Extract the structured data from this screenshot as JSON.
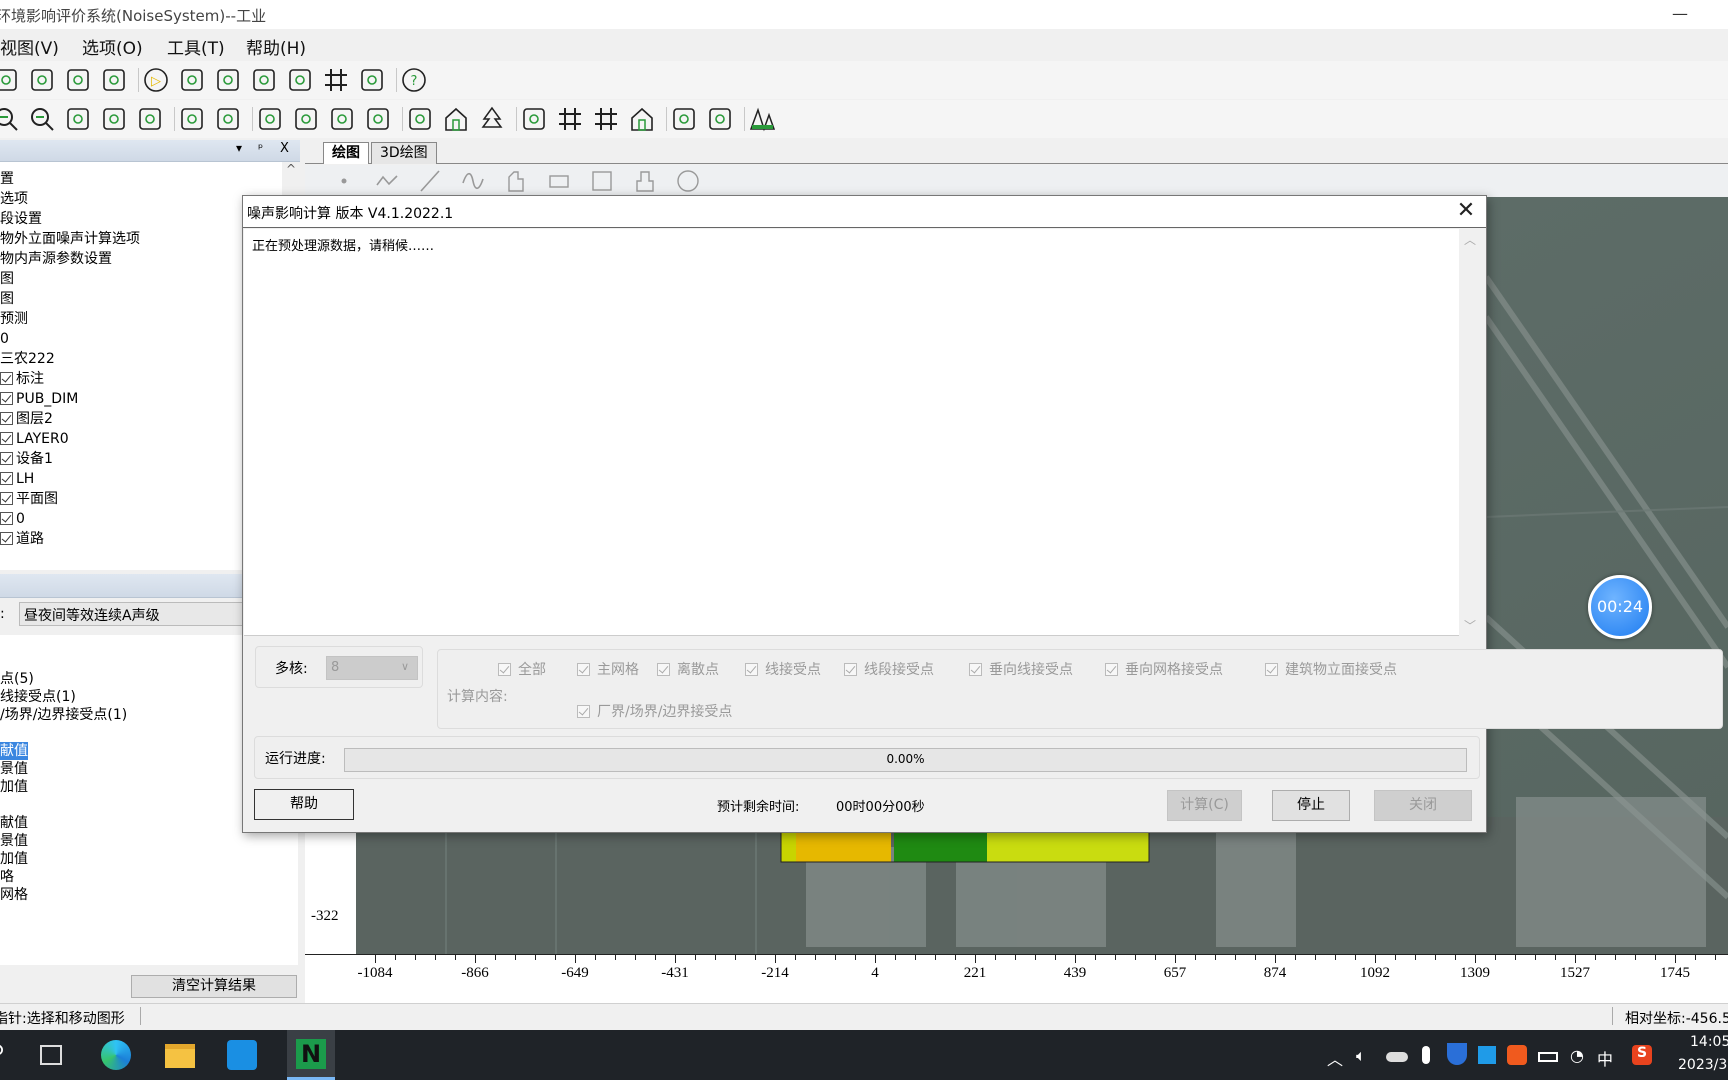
{
  "window": {
    "title": "环境影响评价系统(NoiseSystem)--工业",
    "minimize": "—"
  },
  "menu": [
    "视图(V)",
    "选项(O)",
    "工具(T)",
    "帮助(H)"
  ],
  "toolbar1": [
    "save-icon",
    "view-2d-icon",
    "view-ring-icon",
    "view-3d-icon",
    "|",
    "play-icon",
    "run-hex-icon",
    "image-export-icon",
    "image-print-icon",
    "file-settings-icon",
    "grid-settings-icon",
    "monitor-settings-icon",
    "|",
    "help-icon"
  ],
  "toolbar2": [
    "zoom-in-icon",
    "zoom-out-icon",
    "select-box-icon",
    "select-node-icon",
    "select-polygon-icon",
    "|",
    "ruler-icon",
    "map-refresh-icon",
    "|",
    "factory-icon",
    "car-icon",
    "train-icon",
    "speaker-icon",
    "|",
    "barrier-icon",
    "building-icon",
    "tree-icon",
    "|",
    "pin-icon",
    "line-grid-icon",
    "grid-icon",
    "facade-icon",
    "|",
    "boundary-icon",
    "cube-icon",
    "|",
    "terrain-icon"
  ],
  "left_panel": {
    "header_buttons": [
      "▾",
      "ᵖ",
      "X"
    ],
    "tree": [
      {
        "text": "置",
        "check": false
      },
      {
        "text": "选项",
        "check": false
      },
      {
        "text": "段设置",
        "check": false
      },
      {
        "text": "物外立面噪声计算选项",
        "check": false
      },
      {
        "text": "物内声源参数设置",
        "check": false
      },
      {
        "text": "图",
        "check": false
      },
      {
        "text": "图",
        "check": false
      },
      {
        "text": "预测",
        "check": false
      },
      {
        "text": "0",
        "check": false
      },
      {
        "text": "三农222",
        "check": false
      },
      {
        "text": "标注",
        "check": true
      },
      {
        "text": "PUB_DIM",
        "check": true
      },
      {
        "text": "图层2",
        "check": true
      },
      {
        "text": "LAYER0",
        "check": true
      },
      {
        "text": "设备1",
        "check": true
      },
      {
        "text": "LH",
        "check": true
      },
      {
        "text": "平面图",
        "check": true
      },
      {
        "text": "0",
        "check": true
      },
      {
        "text": "道路",
        "check": true
      }
    ],
    "combo_label": ":",
    "combo_value": "昼夜间等效连续A声级",
    "list": [
      {
        "text": "点(5)",
        "top": 0
      },
      {
        "text": "线接受点(1)",
        "top": 1
      },
      {
        "text": "/场界/边界接受点(1)",
        "top": 2
      },
      {
        "text": "献值",
        "top": 4,
        "selected": true
      },
      {
        "text": "景值",
        "top": 5
      },
      {
        "text": "加值",
        "top": 6
      },
      {
        "text": "献值",
        "top": 8
      },
      {
        "text": "景值",
        "top": 9
      },
      {
        "text": "加值",
        "top": 10
      },
      {
        "text": "咯",
        "top": 11
      },
      {
        "text": "网格",
        "top": 12
      }
    ],
    "clear_button": "清空计算结果"
  },
  "status": {
    "left": "指针:选择和移动图形",
    "right": "相对坐标:-456.5"
  },
  "tabs": [
    {
      "label": "绘图",
      "active": true
    },
    {
      "label": "3D绘图",
      "active": false
    }
  ],
  "draw_tools": [
    "point-icon",
    "polyline-icon",
    "line-icon",
    "curve-icon",
    "polygon-icon",
    "rectangle-icon",
    "square-icon",
    "building-shape-icon",
    "circle-icon"
  ],
  "map": {
    "x_ticks": [
      "-1084",
      "-866",
      "-649",
      "-431",
      "-214",
      "4",
      "221",
      "439",
      "657",
      "874",
      "1092",
      "1309",
      "1527",
      "1745"
    ],
    "y_tick": "-322",
    "contour_colors": [
      "#c8d400",
      "#e6b800",
      "#1f8a12",
      "#c9dc10"
    ]
  },
  "timer": "00:24",
  "dialog": {
    "title": "噪声影响计算 版本 V4.1.2022.1",
    "close": "✕",
    "message": "正在预处理源数据，请稍候……",
    "cores_label": "多核:",
    "cores_value": "8",
    "content_label": "计算内容:",
    "checks": [
      "全部",
      "主网格",
      "离散点",
      "线接受点",
      "线段接受点",
      "垂向线接受点",
      "垂向网格接受点",
      "建筑物立面接受点",
      "厂界/场界/边界接受点"
    ],
    "progress_label": "运行进度:",
    "progress_text": "0.00%",
    "progress": 0,
    "help": "帮助",
    "eta_label": "预计剩余时间:",
    "eta_value": "00时00分00秒",
    "calc": "计算(C)",
    "stop": "停止",
    "close_btn": "关闭"
  },
  "taskbar": {
    "time": "14:05",
    "date": "2023/3",
    "ime": "中",
    "tray_icons": [
      "chevron-up-icon",
      "volume-icon",
      "onedrive-icon",
      "microphone-icon",
      "security-icon",
      "app-icon",
      "app-orange-icon",
      "battery-icon",
      "wifi-icon",
      "ime-icon",
      "sogou-icon"
    ]
  }
}
